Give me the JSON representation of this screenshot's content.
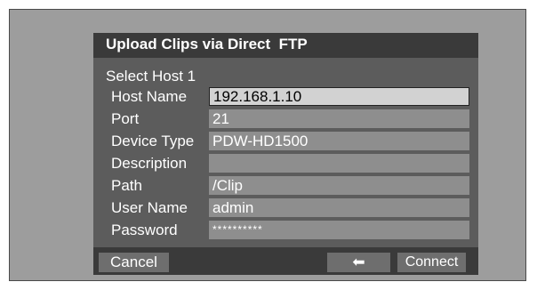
{
  "dialog": {
    "title": "Upload Clips via Direct  FTP",
    "section_title": "Select Host 1"
  },
  "fields": [
    {
      "label": "Host Name",
      "value": "192.168.1.10"
    },
    {
      "label": "Port",
      "value": "21"
    },
    {
      "label": "Device Type",
      "value": "PDW-HD1500"
    },
    {
      "label": "Description",
      "value": ""
    },
    {
      "label": "Path",
      "value": "/Clip"
    },
    {
      "label": "User Name",
      "value": "admin"
    },
    {
      "label": "Password",
      "value": "**********"
    }
  ],
  "buttons": {
    "cancel": "Cancel",
    "back_icon": "left-arrow-icon",
    "back_glyph": "⬅",
    "connect": "Connect"
  },
  "colors": {
    "dialog_bg": "#5c5c5c",
    "title_bar": "#3a3a3a",
    "field_bg": "#8e8e8e",
    "field_focused": "#d2d2d2"
  }
}
